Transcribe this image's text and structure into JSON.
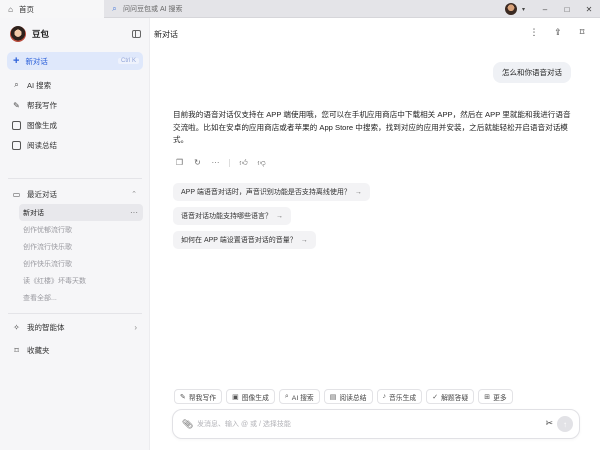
{
  "tabs": {
    "home_label": "首页",
    "search_label": "问问豆包或 AI 搜索"
  },
  "window": {
    "minimize": "–",
    "maximize": "□",
    "close": "✕"
  },
  "sidebar": {
    "brand_name": "豆包",
    "new_chat_label": "新对话",
    "new_chat_kbd": "Ctrl K",
    "items": [
      {
        "label": "AI 搜索",
        "icon": "search-icon"
      },
      {
        "label": "帮我写作",
        "icon": "pen-icon"
      },
      {
        "label": "图像生成",
        "icon": "image-icon"
      },
      {
        "label": "阅读总结",
        "icon": "document-icon"
      }
    ],
    "recent_label": "最近对话",
    "recent": [
      {
        "label": "新对话",
        "active": true
      },
      {
        "label": "创作忧郁流行歌"
      },
      {
        "label": "创作流行快乐歌"
      },
      {
        "label": "创作快乐流行歌"
      },
      {
        "label": "读《红楼》坏毒天数"
      },
      {
        "label": "查看全部..."
      }
    ],
    "agents_label": "我的智能体",
    "favorites_label": "收藏夹"
  },
  "main": {
    "title": "新对话",
    "user_message": "怎么和你语音对话",
    "answer": "目前我的语音对话仅支持在 APP 端使用哦，您可以在手机应用商店中下载相关 APP，然后在 APP 里就能和我进行语音交流啦。比如在安卓的应用商店或者苹果的 App Store 中搜索，找到对应的应用并安装，之后就能轻松开启语音对话模式。",
    "suggestions": [
      "APP 端语音对话时，声音识别功能是否支持离线使用？",
      "语音对话功能支持哪些语言？",
      "如何在 APP 端设置语音对话的音量？"
    ],
    "skills": [
      {
        "label": "帮我写作",
        "icon": "pen-icon"
      },
      {
        "label": "图像生成",
        "icon": "image-icon"
      },
      {
        "label": "AI 搜索",
        "icon": "search-icon"
      },
      {
        "label": "阅读总结",
        "icon": "document-icon"
      },
      {
        "label": "音乐生成",
        "icon": "music-icon"
      },
      {
        "label": "解题答疑",
        "icon": "solve-icon"
      },
      {
        "label": "更多",
        "icon": "grid-icon"
      }
    ],
    "input_placeholder": "发消息、输入 @ 或 / 选择技能"
  }
}
